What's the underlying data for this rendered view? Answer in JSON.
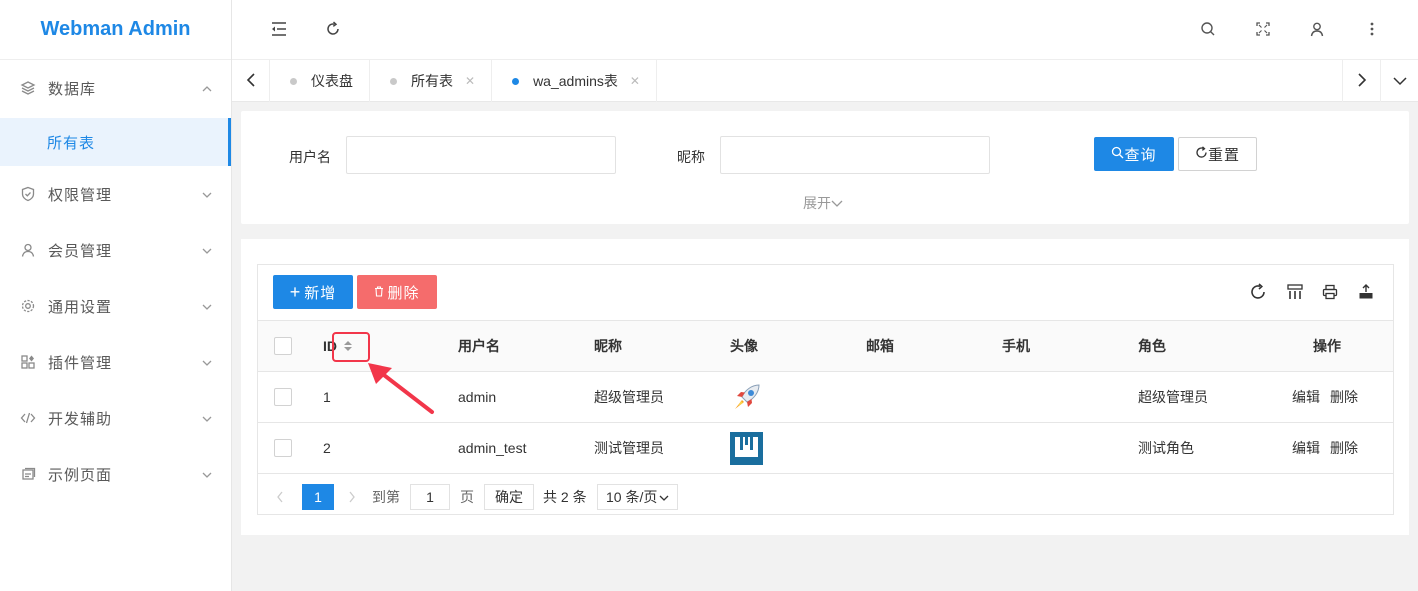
{
  "app": {
    "logo": "Webman Admin"
  },
  "sidebar": {
    "items": [
      {
        "label": "数据库",
        "icon": "layers-icon",
        "expanded": true
      },
      {
        "label": "所有表",
        "sub": true
      },
      {
        "label": "权限管理",
        "icon": "shield-icon"
      },
      {
        "label": "会员管理",
        "icon": "user-icon"
      },
      {
        "label": "通用设置",
        "icon": "gear-icon"
      },
      {
        "label": "插件管理",
        "icon": "apps-icon"
      },
      {
        "label": "开发辅助",
        "icon": "code-icon"
      },
      {
        "label": "示例页面",
        "icon": "page-icon"
      }
    ]
  },
  "header": {
    "icons": [
      "menu-fold-icon",
      "refresh-icon",
      "search-icon",
      "fullscreen-icon",
      "user-icon",
      "more-icon"
    ]
  },
  "tabs": [
    {
      "label": "仪表盘",
      "closable": false
    },
    {
      "label": "所有表",
      "closable": true
    },
    {
      "label": "wa_admins表",
      "closable": true,
      "active": true
    }
  ],
  "search": {
    "fields": [
      {
        "label": "用户名",
        "value": ""
      },
      {
        "label": "昵称",
        "value": ""
      }
    ],
    "query_label": "查询",
    "reset_label": "重置",
    "expand_label": "展开"
  },
  "table": {
    "add_label": "新增",
    "delete_label": "删除",
    "columns": [
      "ID",
      "用户名",
      "昵称",
      "头像",
      "邮箱",
      "手机",
      "角色",
      "操作"
    ],
    "rows": [
      {
        "id": "1",
        "username": "admin",
        "nickname": "超级管理员",
        "avatar": "rocket-avatar",
        "email": "",
        "mobile": "",
        "role": "超级管理员",
        "edit": "编辑",
        "delete": "删除"
      },
      {
        "id": "2",
        "username": "admin_test",
        "nickname": "测试管理员",
        "avatar": "webman-avatar",
        "email": "",
        "mobile": "",
        "role": "测试角色",
        "edit": "编辑",
        "delete": "删除"
      }
    ],
    "pager": {
      "current": "1",
      "goto_prefix": "到第",
      "goto_value": "1",
      "goto_suffix": "页",
      "confirm": "确定",
      "total": "共 2 条",
      "page_size": "10 条/页"
    }
  },
  "colors": {
    "primary": "#1e88e5",
    "danger": "#f56c6c",
    "annotation": "#f2364a"
  }
}
